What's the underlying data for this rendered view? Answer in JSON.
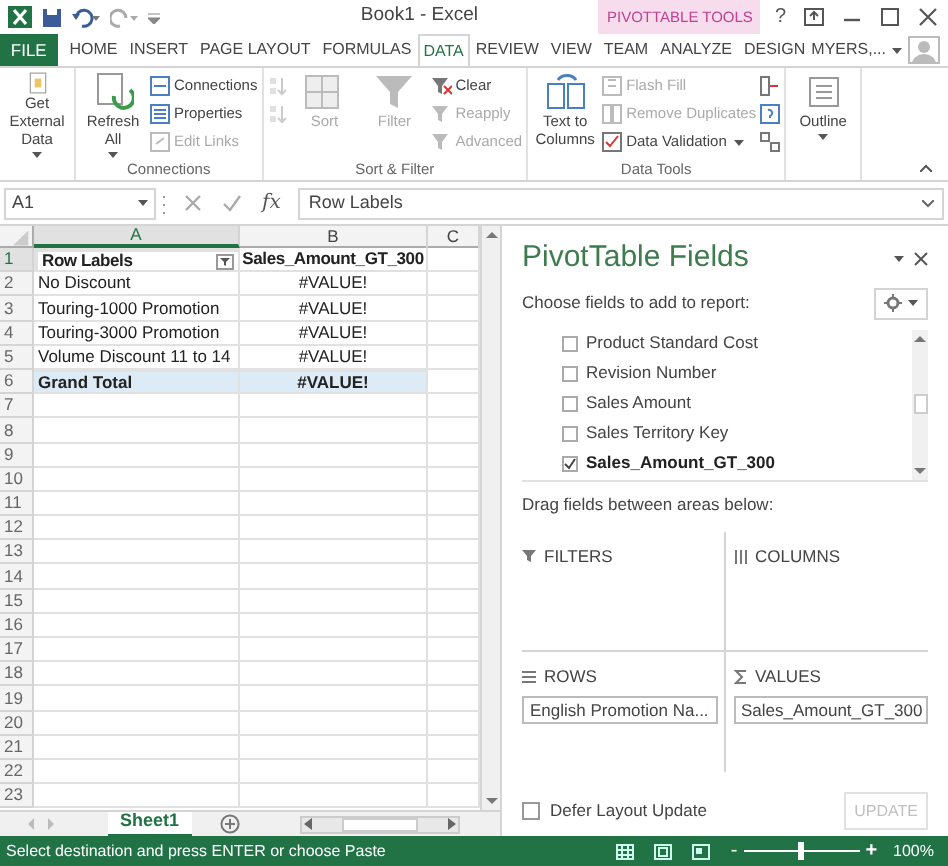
{
  "title_bar": {
    "title": "Book1 - Excel",
    "contextual_group": "PIVOTTABLE TOOLS",
    "help": "?"
  },
  "ribbon_tabs": [
    {
      "label": "FILE",
      "kind": "file",
      "selected": false
    },
    {
      "label": "HOME",
      "kind": "tab",
      "selected": false
    },
    {
      "label": "INSERT",
      "kind": "tab",
      "selected": false
    },
    {
      "label": "PAGE LAYOUT",
      "kind": "tab",
      "selected": false
    },
    {
      "label": "FORMULAS",
      "kind": "tab",
      "selected": false
    },
    {
      "label": "DATA",
      "kind": "tab",
      "selected": true
    },
    {
      "label": "REVIEW",
      "kind": "tab",
      "selected": false
    },
    {
      "label": "VIEW",
      "kind": "tab",
      "selected": false
    },
    {
      "label": "TEAM",
      "kind": "tab",
      "selected": false
    },
    {
      "label": "ANALYZE",
      "kind": "tab",
      "selected": false
    },
    {
      "label": "DESIGN",
      "kind": "tab",
      "selected": false
    }
  ],
  "account": {
    "name": "MYERS,..."
  },
  "ribbon_groups": [
    {
      "items": [
        {
          "label": "Get External Data",
          "kind": "large",
          "dropdown": true,
          "disabled": false
        }
      ]
    },
    {
      "label": "Connections",
      "items": [
        {
          "label": "Refresh All",
          "kind": "large",
          "dropdown": true,
          "disabled": false
        },
        {
          "label": "Connections",
          "kind": "small",
          "dropdown": false,
          "disabled": false
        },
        {
          "label": "Properties",
          "kind": "small",
          "dropdown": false,
          "disabled": false
        },
        {
          "label": "Edit Links",
          "kind": "small",
          "dropdown": false,
          "disabled": true
        }
      ]
    },
    {
      "label": "Sort & Filter",
      "items": [
        {
          "kind": "icon",
          "disabled": true
        },
        {
          "kind": "icon",
          "disabled": true
        },
        {
          "label": "Sort",
          "kind": "large",
          "dropdown": false,
          "disabled": true
        },
        {
          "label": "Filter",
          "kind": "large",
          "dropdown": false,
          "disabled": true
        },
        {
          "label": "Clear",
          "kind": "small",
          "dropdown": false,
          "disabled": false
        },
        {
          "label": "Reapply",
          "kind": "small",
          "dropdown": false,
          "disabled": true
        },
        {
          "label": "Advanced",
          "kind": "small",
          "dropdown": false,
          "disabled": true
        }
      ]
    },
    {
      "label": "Data Tools",
      "items": [
        {
          "label": "Text to Columns",
          "kind": "large",
          "dropdown": false,
          "disabled": false
        },
        {
          "label": "Flash Fill",
          "kind": "small",
          "dropdown": false,
          "disabled": true
        },
        {
          "label": "Remove Duplicates",
          "kind": "small",
          "dropdown": false,
          "disabled": true
        },
        {
          "label": "Data Validation",
          "kind": "small",
          "dropdown": true,
          "disabled": false
        },
        {
          "kind": "icon",
          "disabled": false
        },
        {
          "kind": "icon",
          "disabled": false
        },
        {
          "kind": "icon",
          "disabled": false
        }
      ]
    },
    {
      "items": [
        {
          "label": "Outline",
          "kind": "large",
          "dropdown": true,
          "disabled": false
        }
      ]
    }
  ],
  "formula_bar": {
    "name_box": "A1",
    "function_label": "fx",
    "content": "Row Labels"
  },
  "sheet": {
    "columns": [
      {
        "label": "A",
        "selected": true
      },
      {
        "label": "B",
        "selected": false
      },
      {
        "label": "C",
        "selected": false
      }
    ],
    "rows": [
      {
        "number": "1",
        "kind": "pivot_header",
        "selected": true,
        "cells": [
          "Row Labels",
          "Sales_Amount_GT_300"
        ]
      },
      {
        "number": "2",
        "kind": "item",
        "selected": false,
        "cells": [
          "No Discount",
          "#VALUE!"
        ]
      },
      {
        "number": "3",
        "kind": "item",
        "selected": false,
        "cells": [
          "Touring-1000 Promotion",
          "#VALUE!"
        ]
      },
      {
        "number": "4",
        "kind": "item",
        "selected": false,
        "cells": [
          "Touring-3000 Promotion",
          "#VALUE!"
        ]
      },
      {
        "number": "5",
        "kind": "item",
        "selected": false,
        "cells": [
          "Volume Discount 11 to 14",
          "#VALUE!"
        ]
      },
      {
        "number": "6",
        "kind": "grand_total",
        "selected": false,
        "cells": [
          "Grand Total",
          "#VALUE!"
        ]
      },
      {
        "number": "7",
        "kind": "empty",
        "selected": false
      },
      {
        "number": "8",
        "kind": "empty",
        "selected": false
      },
      {
        "number": "9",
        "kind": "empty",
        "selected": false
      },
      {
        "number": "10",
        "kind": "empty",
        "selected": false
      },
      {
        "number": "11",
        "kind": "empty",
        "selected": false
      },
      {
        "number": "12",
        "kind": "empty",
        "selected": false
      },
      {
        "number": "13",
        "kind": "empty",
        "selected": false
      },
      {
        "number": "14",
        "kind": "empty",
        "selected": false
      },
      {
        "number": "15",
        "kind": "empty",
        "selected": false
      },
      {
        "number": "16",
        "kind": "empty",
        "selected": false
      },
      {
        "number": "17",
        "kind": "empty",
        "selected": false
      },
      {
        "number": "18",
        "kind": "empty",
        "selected": false
      },
      {
        "number": "19",
        "kind": "empty",
        "selected": false
      },
      {
        "number": "20",
        "kind": "empty",
        "selected": false
      },
      {
        "number": "21",
        "kind": "empty",
        "selected": false
      },
      {
        "number": "22",
        "kind": "empty",
        "selected": false
      },
      {
        "number": "23",
        "kind": "empty",
        "selected": false
      }
    ]
  },
  "sheet_tabs": [
    {
      "label": "Sheet1",
      "selected": true
    }
  ],
  "pivot_pane": {
    "title": "PivotTable Fields",
    "instruction": "Choose fields to add to report:",
    "fields": [
      {
        "label": "Product Standard Cost",
        "checked": false
      },
      {
        "label": "Revision Number",
        "checked": false
      },
      {
        "label": "Sales Amount",
        "checked": false
      },
      {
        "label": "Sales Territory Key",
        "checked": false
      },
      {
        "label": "Sales_Amount_GT_300",
        "checked": true
      }
    ],
    "areas_instruction": "Drag fields between areas below:",
    "areas": [
      {
        "label": "FILTERS",
        "kind": "filters"
      },
      {
        "label": "COLUMNS",
        "kind": "columns"
      },
      {
        "label": "ROWS",
        "kind": "rows",
        "items": [
          "English Promotion Na..."
        ]
      },
      {
        "label": "VALUES",
        "kind": "values",
        "items": [
          "Sales_Amount_GT_300"
        ]
      }
    ],
    "defer": {
      "label": "Defer Layout Update",
      "checked": false
    },
    "update_button": {
      "label": "UPDATE",
      "disabled": true
    }
  },
  "status_bar": {
    "message": "Select destination and press ENTER or choose Paste",
    "zoom_out": "-",
    "zoom_in": "+",
    "zoom": {
      "level": 0.5
    },
    "zoom_label": "100%"
  }
}
